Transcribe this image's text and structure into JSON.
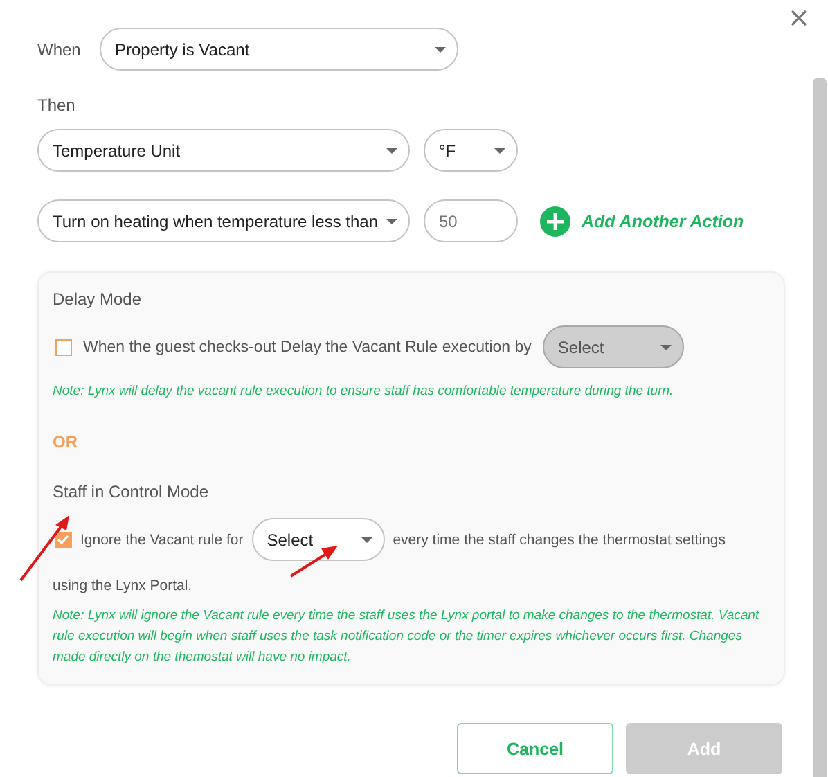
{
  "when": {
    "label": "When",
    "select": {
      "value": "Property is Vacant"
    }
  },
  "then": {
    "label": "Then"
  },
  "actions": [
    {
      "kind": "select",
      "select": {
        "value": "Temperature Unit"
      },
      "extra": {
        "kind": "select",
        "value": "°F"
      }
    },
    {
      "kind": "input",
      "select": {
        "value": "Turn on heating when temperature less than"
      },
      "extra": {
        "kind": "input",
        "placeholder": "50"
      }
    }
  ],
  "add_action": {
    "label": "Add Another Action"
  },
  "delay_mode": {
    "title": "Delay Mode",
    "checked": false,
    "text": "When the guest checks-out Delay the Vacant Rule execution by",
    "select": {
      "value": "Select",
      "disabled": true
    },
    "note": "Note: Lynx will delay the vacant rule execution to ensure staff has comfortable temperature during the turn."
  },
  "or_label": "OR",
  "staff_mode": {
    "title": "Staff in Control Mode",
    "checked": true,
    "text_before": "Ignore the Vacant rule for",
    "select": {
      "value": "Select",
      "disabled": false
    },
    "text_after": "every time the staff changes the thermostat settings",
    "text_wrap": "using the Lynx Portal.",
    "note": "Note: Lynx will ignore the Vacant rule every time the staff uses the Lynx portal to make changes to the thermostat. Vacant rule execution will begin when staff uses the task notification code or the timer expires whichever occurs first. Changes made directly on the themostat will have no impact."
  },
  "buttons": [
    {
      "label": "Cancel",
      "kind": "secondary",
      "disabled": false
    },
    {
      "label": "Add",
      "kind": "primary",
      "disabled": true
    }
  ]
}
